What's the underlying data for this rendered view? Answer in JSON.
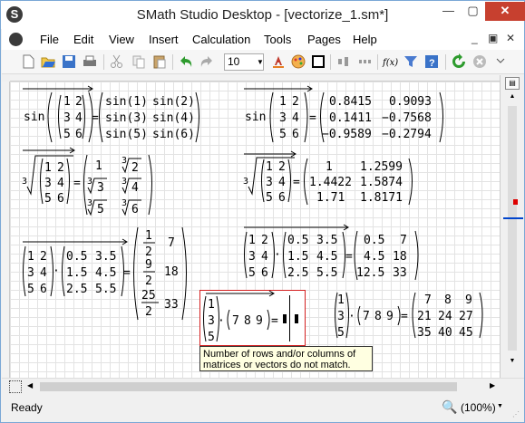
{
  "window": {
    "title": "SMath Studio Desktop - [vectorize_1.sm*]",
    "controls": {
      "minimize": "—",
      "maximize": "▢",
      "close": "✕"
    }
  },
  "menu": {
    "items": [
      "File",
      "Edit",
      "View",
      "Insert",
      "Calculation",
      "Tools",
      "Pages",
      "Help"
    ],
    "mdi_controls": [
      "_",
      "▣",
      "✕"
    ]
  },
  "toolbar": {
    "font_size": "10",
    "icons": [
      "new-document-icon",
      "open-folder-icon",
      "save-icon",
      "print-icon",
      "cut-icon",
      "copy-icon",
      "paste-icon",
      "undo-icon",
      "redo-icon",
      "text-color-icon",
      "palette-icon",
      "border-icon",
      "align-icon",
      "distribute-icon",
      "function-icon",
      "filter-icon",
      "help-icon",
      "recalculate-icon",
      "stop-icon"
    ],
    "function_label": "f(x)"
  },
  "worksheet": {
    "expr1": {
      "func": "sin",
      "matrix": [
        [
          "1",
          "2"
        ],
        [
          "3",
          "4"
        ],
        [
          "5",
          "6"
        ]
      ],
      "result_symbolic": [
        [
          "sin(1)",
          "sin(2)"
        ],
        [
          "sin(3)",
          "sin(4)"
        ],
        [
          "sin(5)",
          "sin(6)"
        ]
      ]
    },
    "expr2": {
      "func": "sin",
      "matrix": [
        [
          "1",
          "2"
        ],
        [
          "3",
          "4"
        ],
        [
          "5",
          "6"
        ]
      ],
      "result": [
        [
          "0.8415",
          "0.9093"
        ],
        [
          "0.1411",
          "−0.7568"
        ],
        [
          "−0.9589",
          "−0.2794"
        ]
      ]
    },
    "expr3": {
      "root_index": "3",
      "matrix": [
        [
          "1",
          "2"
        ],
        [
          "3",
          "4"
        ],
        [
          "5",
          "6"
        ]
      ],
      "result_symbolic": [
        [
          "1",
          "2"
        ],
        [
          "3",
          "4"
        ],
        [
          "5",
          "6"
        ]
      ]
    },
    "expr4": {
      "root_index": "3",
      "matrix": [
        [
          "1",
          "2"
        ],
        [
          "3",
          "4"
        ],
        [
          "5",
          "6"
        ]
      ],
      "result": [
        [
          "1",
          "1.2599"
        ],
        [
          "1.4422",
          "1.5874"
        ],
        [
          "1.71",
          "1.8171"
        ]
      ]
    },
    "expr5": {
      "left": [
        [
          "1",
          "2"
        ],
        [
          "3",
          "4"
        ],
        [
          "5",
          "6"
        ]
      ],
      "right": [
        [
          "0.5",
          "3.5"
        ],
        [
          "1.5",
          "4.5"
        ],
        [
          "2.5",
          "5.5"
        ]
      ],
      "result": [
        [
          "1",
          "2",
          "7"
        ],
        [
          "9",
          "2",
          "18"
        ],
        [
          "25",
          "2",
          "33"
        ]
      ]
    },
    "expr6": {
      "left": [
        [
          "1",
          "2"
        ],
        [
          "3",
          "4"
        ],
        [
          "5",
          "6"
        ]
      ],
      "right": [
        [
          "0.5",
          "3.5"
        ],
        [
          "1.5",
          "4.5"
        ],
        [
          "2.5",
          "5.5"
        ]
      ],
      "result": [
        [
          "0.5",
          "7"
        ],
        [
          "4.5",
          "18"
        ],
        [
          "12.5",
          "33"
        ]
      ]
    },
    "expr7": {
      "column": [
        "1",
        "3",
        "5"
      ],
      "row": [
        "7",
        "8",
        "9"
      ],
      "error_message": "Number of rows and/or columns of matrices or vectors do not match.",
      "error_line1": "Number  of  rows  and/or  columns  of",
      "error_line2": "matrices  or  vectors  do  not  match."
    },
    "expr8": {
      "column": [
        "1",
        "3",
        "5"
      ],
      "row": [
        "7",
        "8",
        "9"
      ],
      "result": [
        [
          "7",
          "8",
          "9"
        ],
        [
          "21",
          "24",
          "27"
        ],
        [
          "35",
          "40",
          "45"
        ]
      ]
    },
    "operators": {
      "dot": "·",
      "equals": "="
    }
  },
  "status": {
    "text": "Ready",
    "zoom": "(100%)"
  }
}
